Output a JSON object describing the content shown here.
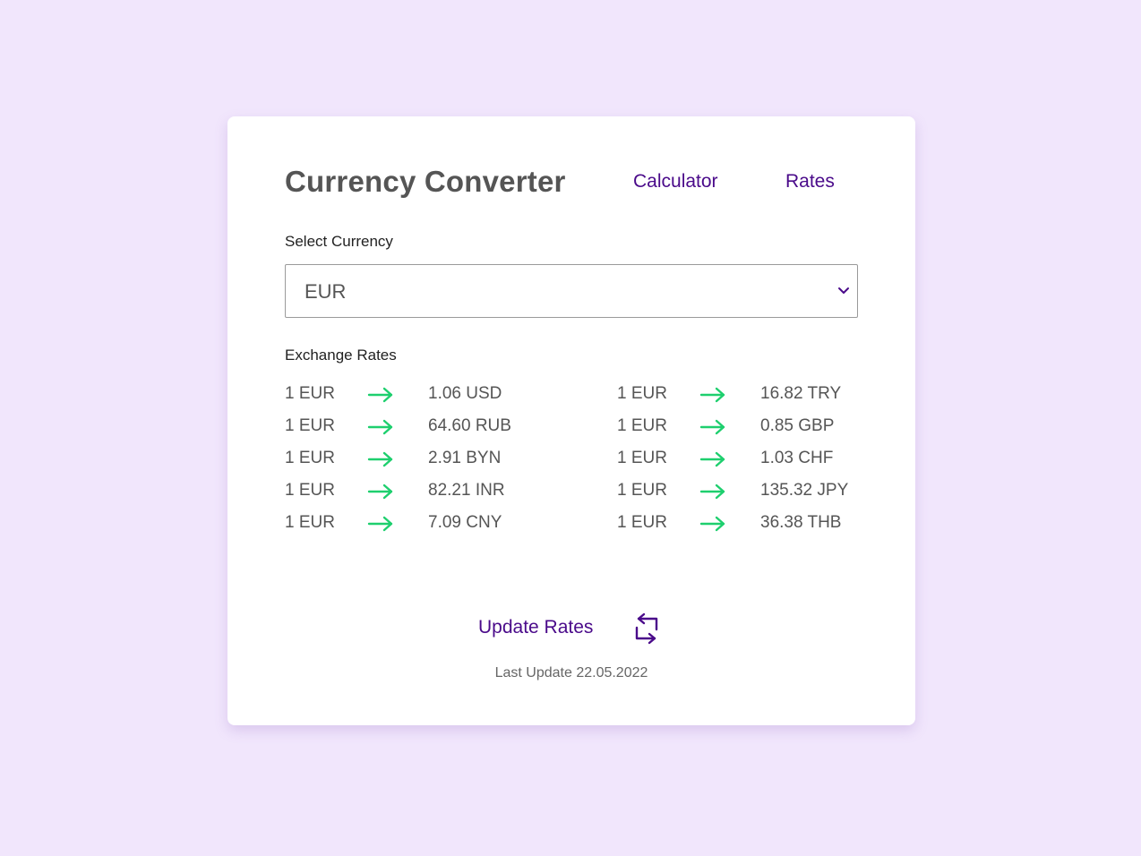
{
  "header": {
    "title": "Currency Converter",
    "nav": [
      {
        "label": "Calculator"
      },
      {
        "label": "Rates"
      }
    ]
  },
  "select": {
    "label": "Select Currency",
    "value": "EUR"
  },
  "rates": {
    "label": "Exchange Rates",
    "left": [
      {
        "base": "1 EUR",
        "target": "1.06 USD"
      },
      {
        "base": "1 EUR",
        "target": "64.60 RUB"
      },
      {
        "base": "1 EUR",
        "target": "2.91 BYN"
      },
      {
        "base": "1 EUR",
        "target": "82.21 INR"
      },
      {
        "base": "1 EUR",
        "target": "7.09 CNY"
      }
    ],
    "right": [
      {
        "base": "1 EUR",
        "target": "16.82 TRY"
      },
      {
        "base": "1 EUR",
        "target": "0.85 GBP"
      },
      {
        "base": "1 EUR",
        "target": "1.03 CHF"
      },
      {
        "base": "1 EUR",
        "target": "135.32 JPY"
      },
      {
        "base": "1 EUR",
        "target": "36.38 THB"
      }
    ]
  },
  "update": {
    "label": "Update Rates",
    "icon": "refresh-icon",
    "last_update": "Last Update 22.05.2022"
  },
  "colors": {
    "background": "#f1e6fc",
    "accent": "#4a0a8a",
    "arrow": "#1ecf6e",
    "text": "#555555"
  }
}
